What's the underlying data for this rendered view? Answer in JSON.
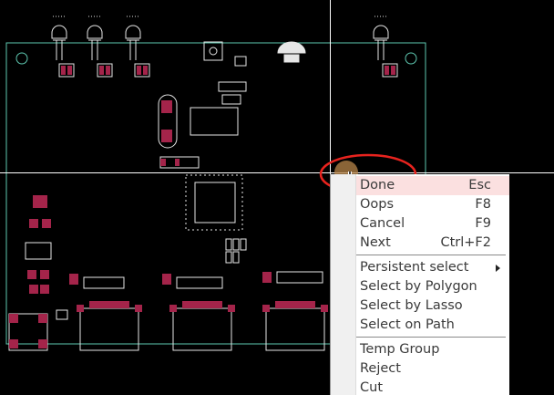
{
  "colors": {
    "board_outline": "#5ec8b0",
    "silkscreen": "#e6e6e6",
    "pad": "#a4244a",
    "crosshair": "#ffffff",
    "highlight_ring": "#e8231e",
    "menu_highlight": "#fbe0e0"
  },
  "context_menu": {
    "items": [
      {
        "label": "Done",
        "shortcut": "Esc"
      },
      {
        "label": "Oops",
        "shortcut": "F8"
      },
      {
        "label": "Cancel",
        "shortcut": "F9"
      },
      {
        "label": "Next",
        "shortcut": "Ctrl+F2"
      },
      {
        "label": "Persistent select",
        "submenu": "arrow-right-icon"
      },
      {
        "label": "Select by Polygon"
      },
      {
        "label": "Select by Lasso"
      },
      {
        "label": "Select on Path"
      },
      {
        "label": "Temp Group"
      },
      {
        "label": "Reject"
      },
      {
        "label": "Cut"
      }
    ]
  },
  "cursor": {
    "icon": "crosshair-move-cursor-icon"
  }
}
